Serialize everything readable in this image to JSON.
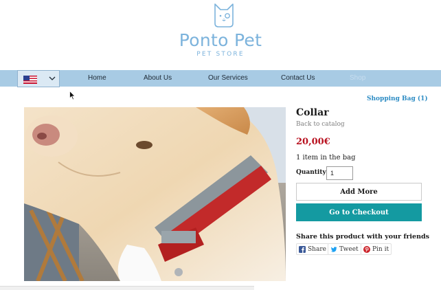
{
  "header": {
    "brand": "Ponto Pet",
    "tagline": "PET STORE",
    "logo_icon": "cat-face-icon"
  },
  "nav": {
    "language_flag": "us-flag-icon",
    "items": [
      {
        "label": "Home"
      },
      {
        "label": "About Us"
      },
      {
        "label": "Our Services"
      },
      {
        "label": "Contact Us"
      },
      {
        "label": "Shop"
      }
    ]
  },
  "cart": {
    "shopping_bag_label": "Shopping Bag (1)"
  },
  "product": {
    "title": "Collar",
    "back_link": "Back to catalog",
    "price": "20,00€",
    "in_bag_text": "1 item in the bag",
    "quantity_label": "Quantity:",
    "quantity_value": "1",
    "add_more_label": "Add More",
    "checkout_label": "Go to Checkout",
    "image_icon": "dog-with-collar-photo"
  },
  "share": {
    "title": "Share this product with your friends",
    "facebook_label": "Share",
    "twitter_label": "Tweet",
    "pinterest_label": "Pin it"
  },
  "colors": {
    "brand": "#7cb3dc",
    "nav_bg": "#a8cbe4",
    "price": "#b8111f",
    "checkout": "#149aa1",
    "link": "#2d8cc4"
  }
}
